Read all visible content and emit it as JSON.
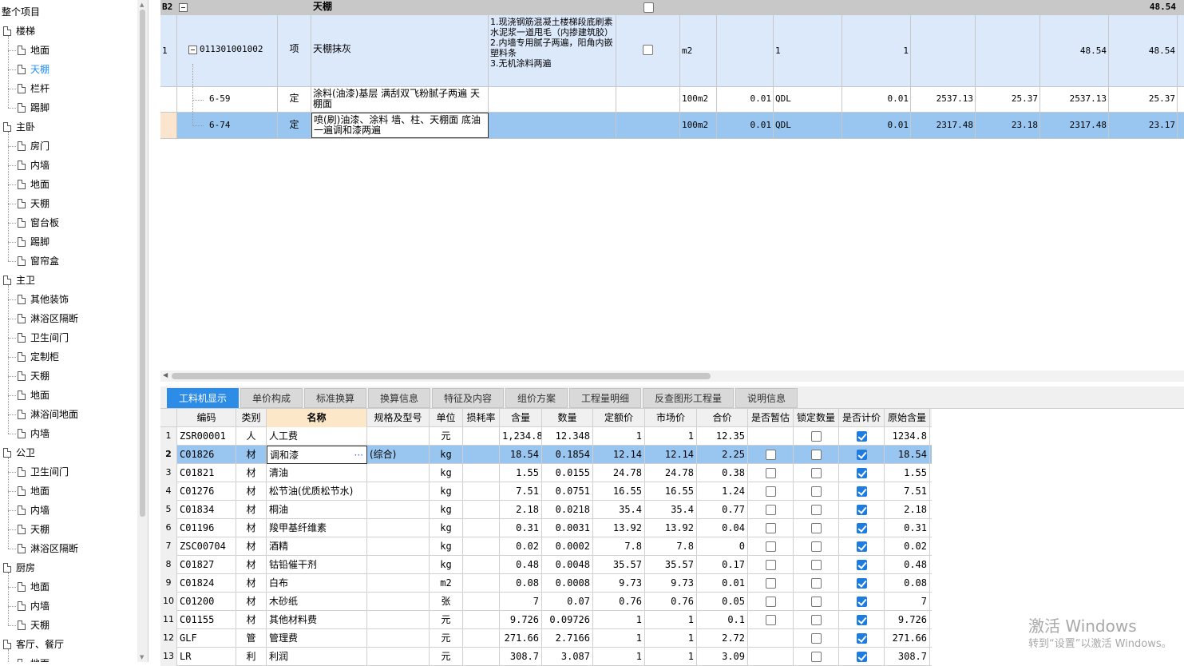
{
  "tree": {
    "root": "整个项目",
    "groups": [
      {
        "label": "楼梯",
        "children": [
          "地面",
          "天棚",
          "栏杆",
          "踢脚"
        ],
        "selected_child": 1
      },
      {
        "label": "主卧",
        "children": [
          "房门",
          "内墙",
          "地面",
          "天棚",
          "窗台板",
          "踢脚",
          "窗帘盒"
        ]
      },
      {
        "label": "主卫",
        "children": [
          "其他装饰",
          "淋浴区隔断",
          "卫生间门",
          "定制柜",
          "天棚",
          "地面",
          "淋浴间地面",
          "内墙"
        ]
      },
      {
        "label": "公卫",
        "children": [
          "卫生间门",
          "地面",
          "内墙",
          "天棚",
          "淋浴区隔断"
        ]
      },
      {
        "label": "厨房",
        "children": [
          "地面",
          "内墙",
          "天棚"
        ]
      },
      {
        "label": "客厅、餐厅",
        "children": [
          "地面"
        ]
      }
    ]
  },
  "top_grid": {
    "header": {
      "code": "B2",
      "name": "天棚",
      "total": "48.54"
    },
    "rows": [
      {
        "num": "1",
        "code": "011301001002",
        "type": "项",
        "name": "天棚抹灰",
        "feature": "1.现浇钢筋混凝土楼梯段底刷素水泥浆一道甩毛（内掺建筑胶）\n2.内墙专用腻子两遍，阳角内嵌塑料条\n3.无机涂料两遍",
        "unit": "m2",
        "c1": "",
        "c2": "1",
        "c3": "1",
        "c4": "",
        "c5": "",
        "c6": "48.54",
        "c7": "48.54"
      },
      {
        "num": "",
        "code": "6-59",
        "type": "定",
        "name": "涂料(油漆)基层 满刮双飞粉腻子两遍 天棚面",
        "feature": "",
        "unit": "100m2",
        "c1": "0.01",
        "c2": "QDL",
        "c3": "0.01",
        "c4": "2537.13",
        "c5": "25.37",
        "c6": "2537.13",
        "c7": "25.37"
      },
      {
        "num": "",
        "code": "6-74",
        "type": "定",
        "name": "喷(刷)油漆、涂料 墙、柱、天棚面 底油一遍调和漆两遍",
        "feature": "",
        "unit": "100m2",
        "c1": "0.01",
        "c2": "QDL",
        "c3": "0.01",
        "c4": "2317.48",
        "c5": "23.18",
        "c6": "2317.48",
        "c7": "23.17"
      }
    ]
  },
  "tabs": [
    "工料机显示",
    "单价构成",
    "标准换算",
    "换算信息",
    "特征及内容",
    "组价方案",
    "工程量明细",
    "反查图形工程量",
    "说明信息"
  ],
  "bottom_grid": {
    "headers": [
      "编码",
      "类别",
      "名称",
      "规格及型号",
      "单位",
      "损耗率",
      "含量",
      "数量",
      "定额价",
      "市场价",
      "合价",
      "是否暂估",
      "锁定数量",
      "是否计价",
      "原始含量"
    ],
    "rows": [
      {
        "n": "1",
        "code": "ZSR00001",
        "cat": "人",
        "name": "人工费",
        "spec": "",
        "unit": "元",
        "loss": "",
        "qty": "1,234.8",
        "amt": "12.348",
        "dp": "1",
        "mp": "1",
        "tot": "12.35",
        "est": null,
        "lock": false,
        "calc": true,
        "orig": "1234.8"
      },
      {
        "n": "2",
        "code": "C01826",
        "cat": "材",
        "name": "调和漆",
        "spec": "(综合)",
        "unit": "kg",
        "loss": "",
        "qty": "18.54",
        "amt": "0.1854",
        "dp": "12.14",
        "mp": "12.14",
        "tot": "2.25",
        "est": false,
        "lock": false,
        "calc": true,
        "orig": "18.54"
      },
      {
        "n": "3",
        "code": "C01821",
        "cat": "材",
        "name": "清油",
        "spec": "",
        "unit": "kg",
        "loss": "",
        "qty": "1.55",
        "amt": "0.0155",
        "dp": "24.78",
        "mp": "24.78",
        "tot": "0.38",
        "est": false,
        "lock": false,
        "calc": true,
        "orig": "1.55"
      },
      {
        "n": "4",
        "code": "C01276",
        "cat": "材",
        "name": "松节油(优质松节水)",
        "spec": "",
        "unit": "kg",
        "loss": "",
        "qty": "7.51",
        "amt": "0.0751",
        "dp": "16.55",
        "mp": "16.55",
        "tot": "1.24",
        "est": false,
        "lock": false,
        "calc": true,
        "orig": "7.51"
      },
      {
        "n": "5",
        "code": "C01834",
        "cat": "材",
        "name": "桐油",
        "spec": "",
        "unit": "kg",
        "loss": "",
        "qty": "2.18",
        "amt": "0.0218",
        "dp": "35.4",
        "mp": "35.4",
        "tot": "0.77",
        "est": false,
        "lock": false,
        "calc": true,
        "orig": "2.18"
      },
      {
        "n": "6",
        "code": "C01196",
        "cat": "材",
        "name": "羧甲基纤维素",
        "spec": "",
        "unit": "kg",
        "loss": "",
        "qty": "0.31",
        "amt": "0.0031",
        "dp": "13.92",
        "mp": "13.92",
        "tot": "0.04",
        "est": false,
        "lock": false,
        "calc": true,
        "orig": "0.31"
      },
      {
        "n": "7",
        "code": "ZSC00704",
        "cat": "材",
        "name": "酒精",
        "spec": "",
        "unit": "kg",
        "loss": "",
        "qty": "0.02",
        "amt": "0.0002",
        "dp": "7.8",
        "mp": "7.8",
        "tot": "0",
        "est": false,
        "lock": false,
        "calc": true,
        "orig": "0.02"
      },
      {
        "n": "8",
        "code": "C01827",
        "cat": "材",
        "name": "钴铅催干剂",
        "spec": "",
        "unit": "kg",
        "loss": "",
        "qty": "0.48",
        "amt": "0.0048",
        "dp": "35.57",
        "mp": "35.57",
        "tot": "0.17",
        "est": false,
        "lock": false,
        "calc": true,
        "orig": "0.48"
      },
      {
        "n": "9",
        "code": "C01824",
        "cat": "材",
        "name": "白布",
        "spec": "",
        "unit": "m2",
        "loss": "",
        "qty": "0.08",
        "amt": "0.0008",
        "dp": "9.73",
        "mp": "9.73",
        "tot": "0.01",
        "est": false,
        "lock": false,
        "calc": true,
        "orig": "0.08"
      },
      {
        "n": "10",
        "code": "C01200",
        "cat": "材",
        "name": "木砂纸",
        "spec": "",
        "unit": "张",
        "loss": "",
        "qty": "7",
        "amt": "0.07",
        "dp": "0.76",
        "mp": "0.76",
        "tot": "0.05",
        "est": false,
        "lock": false,
        "calc": true,
        "orig": "7"
      },
      {
        "n": "11",
        "code": "C01155",
        "cat": "材",
        "name": "其他材料费",
        "spec": "",
        "unit": "元",
        "loss": "",
        "qty": "9.726",
        "amt": "0.09726",
        "dp": "1",
        "mp": "1",
        "tot": "0.1",
        "est": false,
        "lock": false,
        "calc": true,
        "orig": "9.726"
      },
      {
        "n": "12",
        "code": "GLF",
        "cat": "管",
        "name": "管理费",
        "spec": "",
        "unit": "元",
        "loss": "",
        "qty": "271.66",
        "amt": "2.7166",
        "dp": "1",
        "mp": "1",
        "tot": "2.72",
        "est": null,
        "lock": false,
        "calc": true,
        "orig": "271.66"
      },
      {
        "n": "13",
        "code": "LR",
        "cat": "利",
        "name": "利润",
        "spec": "",
        "unit": "元",
        "loss": "",
        "qty": "308.7",
        "amt": "3.087",
        "dp": "1",
        "mp": "1",
        "tot": "3.09",
        "est": null,
        "lock": false,
        "calc": true,
        "orig": "308.7"
      }
    ]
  },
  "watermark": {
    "line1": "激活 Windows",
    "line2": "转到“设置”以激活 Windows。"
  },
  "colors": {
    "accent": "#2d8ce6",
    "selected_row": "#99c6f0",
    "item_row": "#dce9fb",
    "name_header": "#fde7c9"
  }
}
